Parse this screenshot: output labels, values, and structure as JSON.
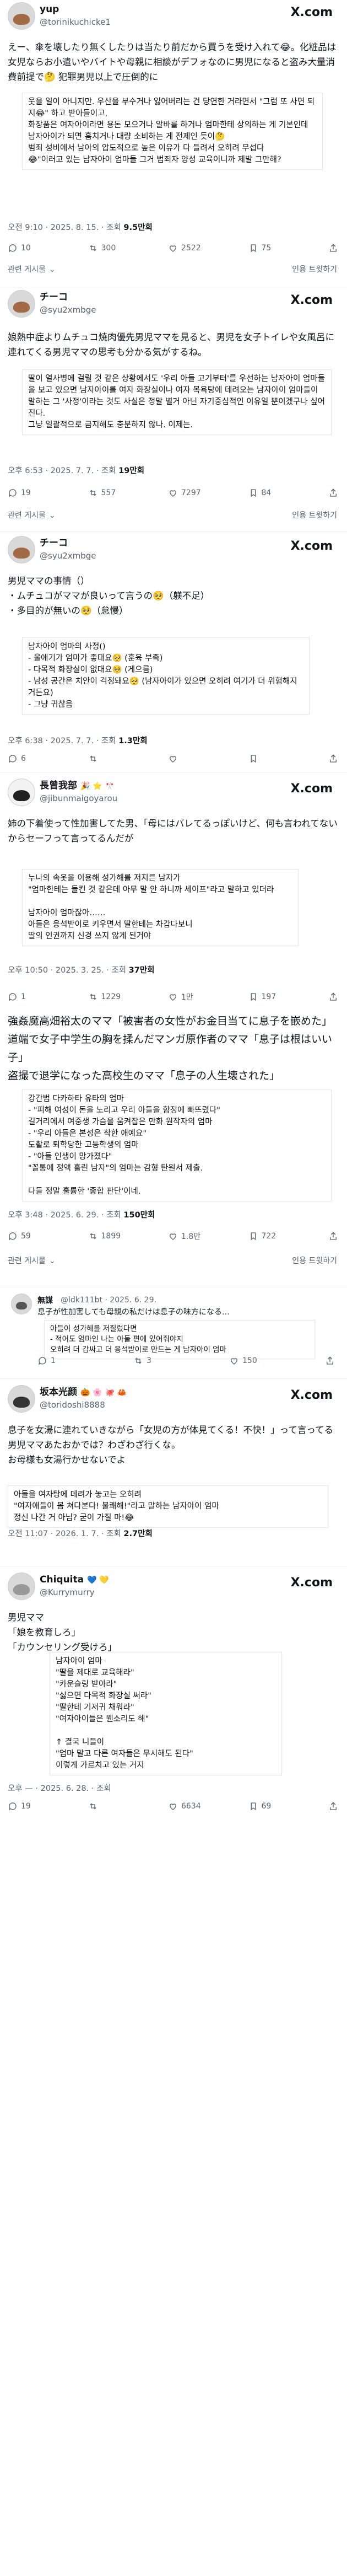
{
  "posts": [
    {
      "name": "yup",
      "handle": "@torinikuchicke1",
      "text": "えー、傘を壊したり無くしたりは当たり前だから買うを受け入れて😂。化粧品は女児ならお小遣いやバイトや母親に相談がデフォなのに男児になると盗み大量消費前提で🤔 犯罪男児以上で圧倒的に",
      "quoted": "웃을 일이 아니지만. 우산을 부수거나 잃어버리는 건 당연한 거라면서 \"그럼 또 사면 되지😂\" 하고 받아들이고,\n화장품은 여자아이라면 용돈 모으거나 알바를 하거나 엄마한테 상의하는 게 기본인데\n남자아이가 되면 훔치거나 대량 소비하는 게 전제인 듯이🤔\n범죄 성비에서 남아의 압도적으로 높은 이유가 다 들려서 오히려 무섭다\n😂\"이러고 있는 남자아이 엄마들 그거 범죄자 양성 교육이니까 제발 그만해?",
      "meta_time": "오전 9:10 · 2025. 8. 15. · 조회",
      "meta_views": "9.5만회",
      "replies": "10",
      "reposts": "300",
      "likes": "2522",
      "bookmarks": "75"
    },
    {
      "name": "チーコ",
      "handle": "@syu2xmbge",
      "text": "娘熱中症よりムチュコ焼肉優先男児ママを見ると、男児を女子トイレや女風呂に連れてくる男児ママの思考も分かる気がするね。",
      "quoted": "딸이 열사병에 걸릴 것 같은 상황에서도 '우리 아들 고기부터'를 우선하는 남자아이 엄마들을 보고 있으면 남자아이를 여자 화장실이나 여자 목욕탕에 데려오는 남자아이 엄마들이 말하는 그 '사정'이라는 것도 사실은 정말 별거 아닌 자기중심적인 이유일 뿐이겠구나 싶어진다.\n그냥 일괄적으로 금지해도 충분하지 않나. 이제는.",
      "meta_time": "오후 6:53 · 2025. 7. 7. · 조회",
      "meta_views": "19만회",
      "replies": "19",
      "reposts": "557",
      "likes": "7297",
      "bookmarks": "84"
    },
    {
      "name": "チーコ",
      "handle": "@syu2xmbge",
      "text": "男児ママの事情（）\n・ムチュコがママが良いって言うの🥺（躾不足）\n・多目的が無いの🥺（怠慢）",
      "quoted": "남자아이 엄마의 사정()\n- 울애기가 엄마가 좋대요🥺 (훈육 부족)\n- 다목적 화장실이 없대요🥺 (게으름)\n- 남성 공간은 치안이 걱정돼요🥺 (남자아이가 있으면 오히려 여기가 더 위험해지거든요)\n- 그냥 귀찮음",
      "meta_time": "오후 6:38 · 2025. 7. 7. · 조회",
      "meta_views": "1.3만회",
      "replies": "6",
      "reposts": "",
      "likes": "",
      "bookmarks": ""
    },
    {
      "name": "長曾我部",
      "handle": "@jibunmaigoyarou",
      "text": "姉の下着使って性加害してた男、「母にはバレてるっぽいけど、何も言われてないからセーフって言ってるんだが",
      "quoted": "누나의 속옷을 이용해 성가해를 저지른 남자가\n\"엄마한테는 들킨 것 같은데 아무 말 안 하니까 세이프\"라고 말하고 있더라\n\n남자아이 엄마잖아……\n아들은 응석받이로 키우면서 딸한테는 차갑다보니\n딸의 인권까지 신경 쓰지 않게 된거야",
      "meta_time": "오후 10:50 · 2025. 3. 25. · 조회",
      "meta_views": "37만회",
      "replies": "1",
      "reposts": "1229",
      "likes": "1만",
      "bookmarks": "197"
    },
    {
      "name": "",
      "handle": "",
      "text": "強姦魔高畑裕太のママ「被害者の女性がお金目当てに息子を嵌めた」\n道端で女子中学生の胸を揉んだマンガ原作者のママ「息子は根はいい子」\n盗撮で退学になった高校生のママ「息子の人生壊された」",
      "quoted": "강간범 다카하타 유타의 엄마\n- \"피해 여성이 돈을 노리고 우리 아들을 함정에 빠뜨렸다\"\n길거리에서 여중생 가슴을 움켜잡은 만화 원작자의 엄마\n- \"우리 아들은 본성은 착한 애예요\"\n도촬로 퇴학당한 고등학생의 엄마\n- \"아들 인생이 망가졌다\"\n\"꼴통에 정액 흘린 남자\"의 엄마는 감형 탄원서 제출.\n\n다들 정말 훌륭한 '종합 판단'이네.",
      "meta_time": "오후 3:48 · 2025. 6. 29. · 조회",
      "meta_views": "150만회",
      "replies": "59",
      "reposts": "1899",
      "likes": "1.8만",
      "bookmarks": "722"
    },
    {
      "name": "無謀",
      "handle": "@ldk111bt · 2025. 6. 29.",
      "text": "息子が性加害しても母親の私だけは息子の味方になる…",
      "quoted": "아들이 성가해를 저질렀다면\n- 적어도 엄마인 나는 아들 편에 있어줘야지\n오히려 더 감싸고 더 응석받이로 만드는 게 남자아이 엄마",
      "meta_time": "",
      "meta_views": "",
      "replies": "1",
      "reposts": "3",
      "likes": "150",
      "bookmarks": ""
    },
    {
      "name": "坂本光颜",
      "handle": "@toridoshi8888",
      "text": "息子を女湯に連れていきながら「女児の方が体見てくる！不快！」って言ってる男児ママあたおかでは？わざわざ行くな。\nお母様も女湯行かせないでよ",
      "quoted": "아들을 여자탕에 데려가 놓고는 오히려\n\"여자애들이 몸 쳐다본다! 불쾌해!\"라고 말하는 남자아이 엄마\n정신 나간 거 아님? 굳이 가질 마!😂",
      "meta_time": "오전 11:07 · 2026. 1. 7. · 조회",
      "meta_views": "2.7만회",
      "replies": "",
      "reposts": "",
      "likes": "",
      "bookmarks": ""
    },
    {
      "name": "Chiquita",
      "handle": "@Kurrymurry",
      "text": "男児ママ\n「娘を教育しろ」\n「カウンセリング受けろ」",
      "quoted": "남자아이 엄마\n\"딸을 제대로 교육해라\"\n\"카운슬링 받아라\"\n\"싫으면 다목적 화장실 써라\"\n\"딸한테 기저귀 채워라\"\n\"여자아이들은 웬소리도 해\"\n\n↑ 결국 니들이\n\"엄마 말고 다른 여자들은 무시해도 된다\"\n이렇게 가르치고 있는 거지",
      "meta_time": "오후 — · 2025. 6. 28. · 조회",
      "meta_views": "",
      "replies": "19",
      "reposts": "",
      "likes": "6634",
      "bookmarks": "69"
    }
  ],
  "common": {
    "x_label": "X.com",
    "related": "관련 게시물",
    "quote_link": "인용 트윗하기"
  }
}
